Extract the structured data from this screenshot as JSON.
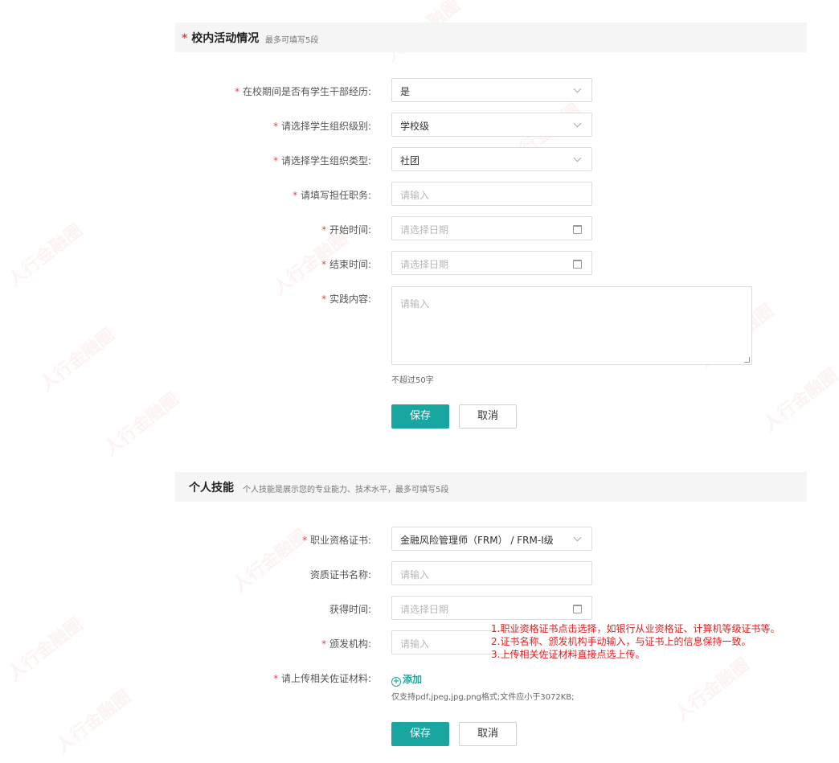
{
  "watermark": "人行金融圈",
  "campus": {
    "title": "校内活动情况",
    "subtitle": "最多可填写5段",
    "fields": [
      {
        "label": "在校期间是否有学生干部经历:",
        "value": "是",
        "type": "select"
      },
      {
        "label": "请选择学生组织级别:",
        "value": "学校级",
        "type": "select"
      },
      {
        "label": "请选择学生组织类型:",
        "value": "社团",
        "type": "select"
      },
      {
        "label": "请填写担任职务:",
        "placeholder": "请输入",
        "type": "input"
      },
      {
        "label": "开始时间:",
        "placeholder": "请选择日期",
        "type": "date"
      },
      {
        "label": "结束时间:",
        "placeholder": "请选择日期",
        "type": "date"
      },
      {
        "label": "实践内容:",
        "placeholder": "请输入",
        "type": "textarea"
      }
    ],
    "content_hint": "不超过50字",
    "save_label": "保存",
    "cancel_label": "取消"
  },
  "skills": {
    "title": "个人技能",
    "subtitle": "个人技能是展示您的专业能力、技术水平，最多可填写5段",
    "fields": [
      {
        "label": "职业资格证书:",
        "value": "金融风险管理师（FRM） / FRM-I级",
        "type": "select",
        "required": true
      },
      {
        "label": "资质证书名称:",
        "placeholder": "请输入",
        "type": "input",
        "required": false
      },
      {
        "label": "获得时间:",
        "placeholder": "请选择日期",
        "type": "date",
        "required": false
      },
      {
        "label": "颁发机构:",
        "placeholder": "请输入",
        "type": "input",
        "required": true
      }
    ],
    "upload_label": "请上传相关佐证材料:",
    "add_label": "添加",
    "upload_hint": "仅支持pdf,jpeg,jpg,png格式;文件应小于3072KB;",
    "save_label": "保存",
    "cancel_label": "取消"
  },
  "annotation": [
    "1.职业资格证书点击选择，如银行从业资格证、计算机等级证书等。",
    "2.证书名称、颁发机构手动输入，与证书上的信息保持一致。",
    "3.上传相关佐证材料直接点选上传。"
  ],
  "colors": {
    "accent": "#1aa6a0",
    "required": "#e64545",
    "annotation": "#e22020"
  }
}
